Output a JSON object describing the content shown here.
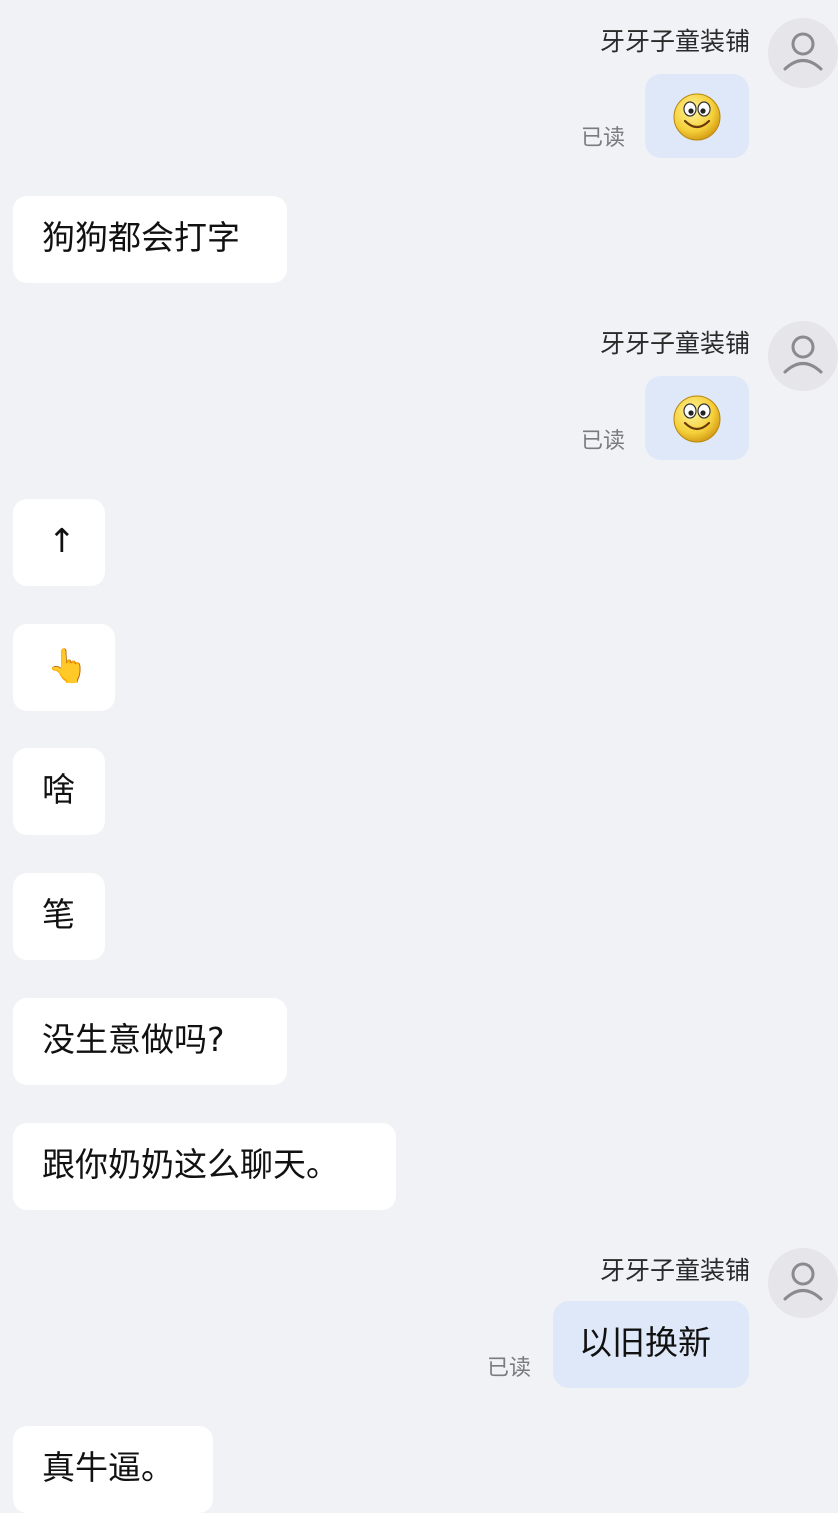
{
  "shop_name": "牙牙子童装铺",
  "read_label": "已读",
  "messages": [
    {
      "side": "out",
      "kind": "emoji",
      "emoji": "smile-emoji"
    },
    {
      "side": "in",
      "text": "狗狗都会打字"
    },
    {
      "side": "out",
      "kind": "emoji",
      "emoji": "smile-emoji"
    },
    {
      "side": "in",
      "text": "↑"
    },
    {
      "side": "in",
      "text": "👆"
    },
    {
      "side": "in",
      "text": "啥"
    },
    {
      "side": "in",
      "text": "笔"
    },
    {
      "side": "in",
      "text": "没生意做吗?"
    },
    {
      "side": "in",
      "text": "跟你奶奶这么聊天。"
    },
    {
      "side": "out",
      "text": "以旧换新"
    },
    {
      "side": "in",
      "text": "真牛逼。"
    }
  ],
  "colors": {
    "background": "#f1f2f6",
    "outgoing_bubble": "#dfe8f8",
    "incoming_bubble": "#ffffff"
  }
}
